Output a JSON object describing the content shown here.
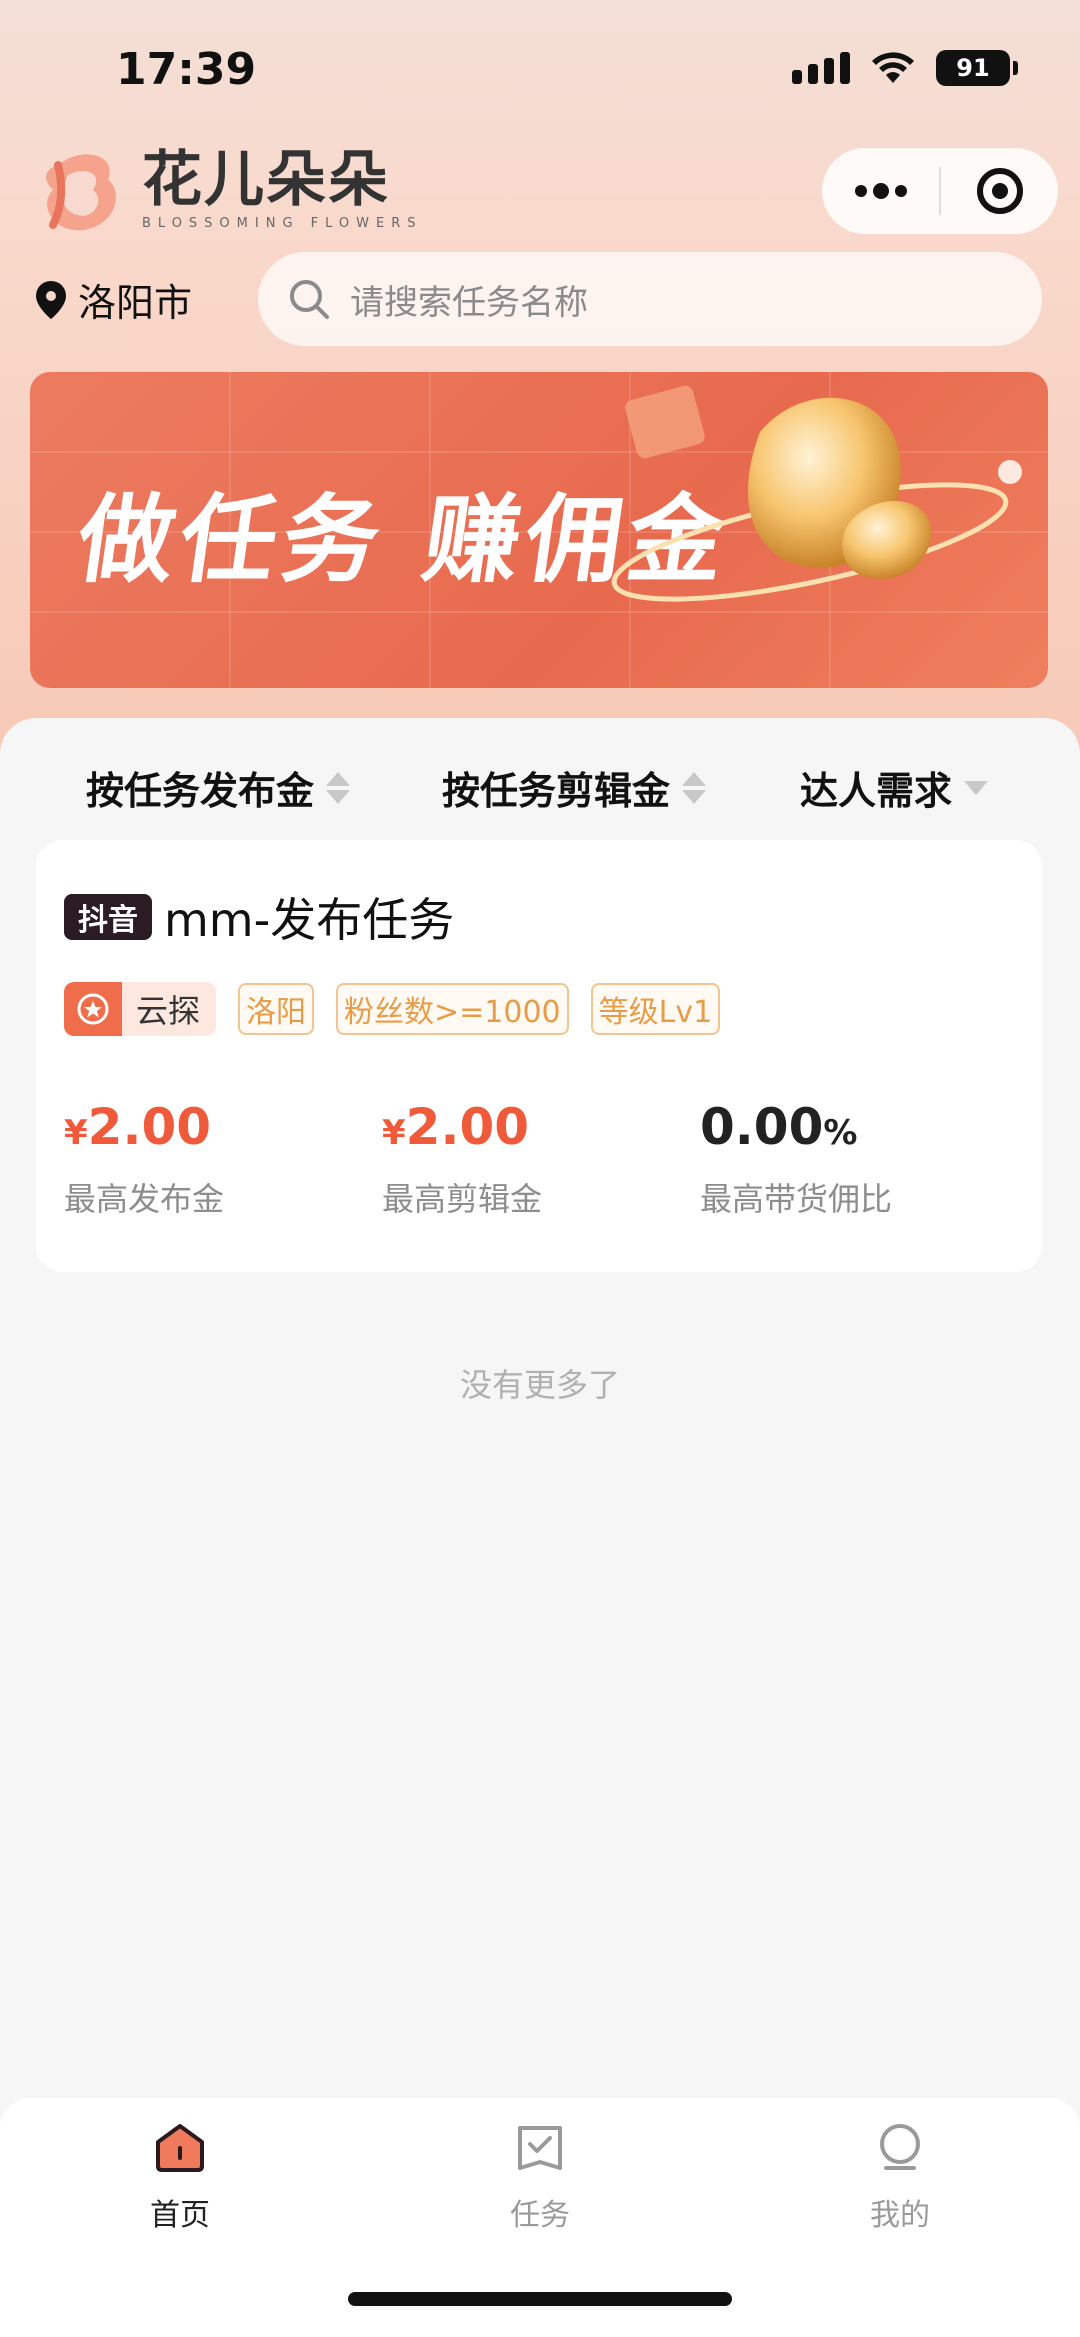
{
  "status_bar": {
    "time": "17:39",
    "battery": "91"
  },
  "brand": {
    "name_cn": "花儿朵朵",
    "name_en": "BLOSSOMING FLOWERS"
  },
  "location": {
    "city": "洛阳市"
  },
  "search": {
    "placeholder": "请搜索任务名称"
  },
  "banner": {
    "text": "做任务 赚佣金"
  },
  "filters": [
    {
      "label": "按任务发布金"
    },
    {
      "label": "按任务剪辑金"
    },
    {
      "label": "达人需求"
    }
  ],
  "task_card": {
    "platform": "抖音",
    "title": "mm-发布任务",
    "tags": {
      "type": "云探",
      "city": "洛阳",
      "fans": "粉丝数>=1000",
      "level": "等级Lv1"
    },
    "stats": [
      {
        "currency": "¥",
        "value": "2.00",
        "label": "最高发布金"
      },
      {
        "currency": "¥",
        "value": "2.00",
        "label": "最高剪辑金"
      },
      {
        "value": "0.00",
        "unit": "%",
        "label": "最高带货佣比"
      }
    ]
  },
  "list_end": "没有更多了",
  "tabbar": [
    {
      "label": "首页",
      "active": true
    },
    {
      "label": "任务",
      "active": false
    },
    {
      "label": "我的",
      "active": false
    }
  ],
  "colors": {
    "accent": "#ee5a3a",
    "tag_orange": "#e99c48",
    "inactive_tab": "#9a9a9a"
  }
}
